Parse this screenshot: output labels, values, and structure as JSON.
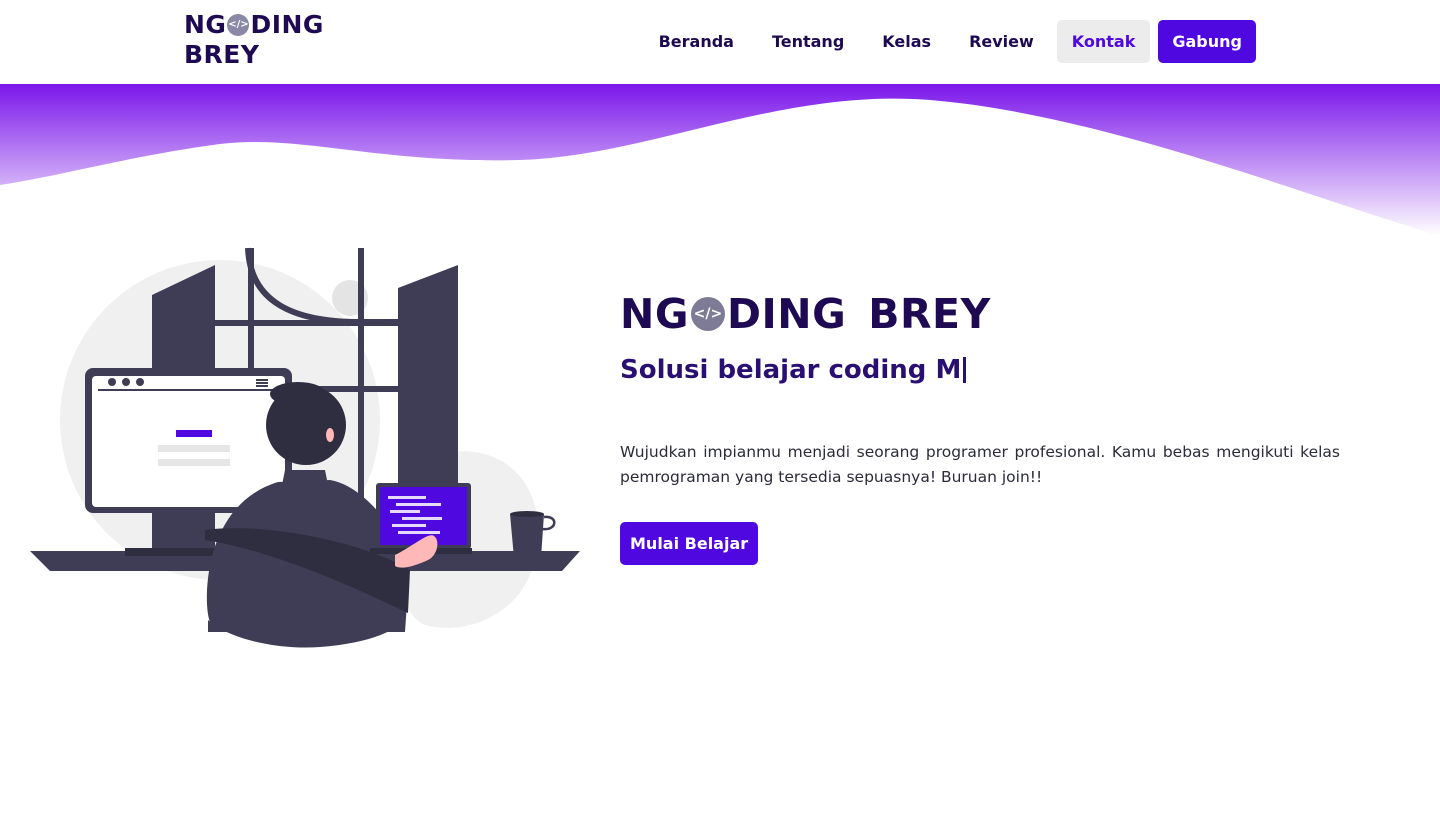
{
  "brand": {
    "line1_prefix": "NG",
    "code_icon": "</>",
    "line1_suffix": "DING",
    "line2": "BREY"
  },
  "nav": {
    "items": [
      {
        "label": "Beranda"
      },
      {
        "label": "Tentang"
      },
      {
        "label": "Kelas"
      },
      {
        "label": "Review"
      },
      {
        "label": "Kontak"
      }
    ],
    "join_label": "Gabung"
  },
  "hero": {
    "title_prefix": "NG",
    "code_icon": "</>",
    "title_mid": "DING",
    "title_word2": "BREY",
    "subtitle": "Solusi belajar coding M",
    "description": "Wujudkan impianmu menjadi seorang programer profesional. Kamu bebas mengikuti kelas pemrograman yang tersedia sepuasnya! Buruan join!!",
    "cta_label": "Mulai Belajar"
  },
  "colors": {
    "primary": "#4f08e0",
    "dark_text": "#1e0a52",
    "wave_top": "#7b16ea",
    "wave_bottom": "#ffffff"
  },
  "icons": [
    "code-icon",
    "browser-window-icon",
    "laptop-icon",
    "coffee-mug-icon"
  ]
}
